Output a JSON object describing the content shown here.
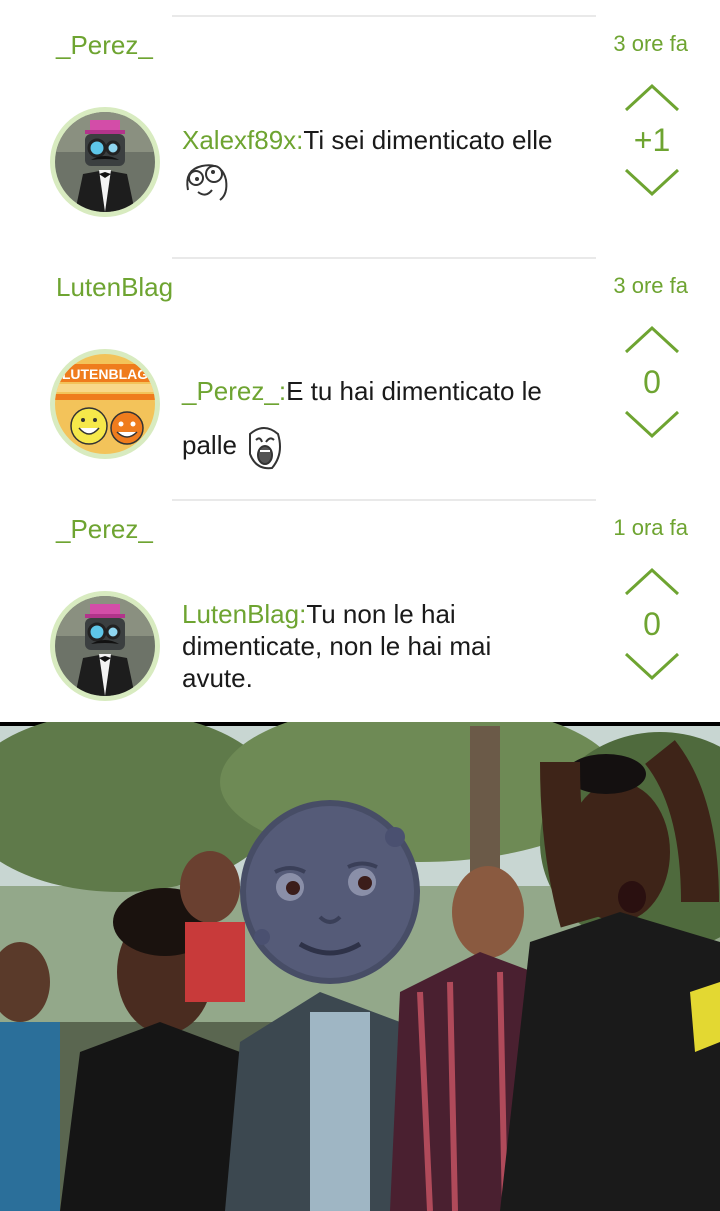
{
  "comments": [
    {
      "author": "_Perez_",
      "time": "3 ore fa",
      "mention": "Xalexf89x:",
      "text": "Ti sei dimenticato elle",
      "score": "+1",
      "avatar": "top-hat-robot-avatar",
      "emoji": "derp-rage-face"
    },
    {
      "author": "LutenBlag",
      "time": "3 ore fa",
      "mention": "_Perez_:",
      "text": "E tu hai dimenticato le palle",
      "score": "0",
      "avatar": "lutenblag-logo-avatar",
      "avatar_text": "LUTENBLAG",
      "emoji": "lol-rage-face"
    },
    {
      "author": "_Perez_",
      "time": "1 ora fa",
      "mention": "LutenBlag:",
      "text": "Tu non le hai dimenticate, non le hai mai avute.",
      "score": "0",
      "avatar": "top-hat-robot-avatar"
    }
  ],
  "meme": {
    "image": "reaction-crowd-with-moon-face",
    "emoji": "new-moon-with-face"
  },
  "colors": {
    "accent": "#6ea431",
    "avatar_ring": "#d8ebc0",
    "divider": "#e9e9e9",
    "text": "#1a1a1a"
  }
}
